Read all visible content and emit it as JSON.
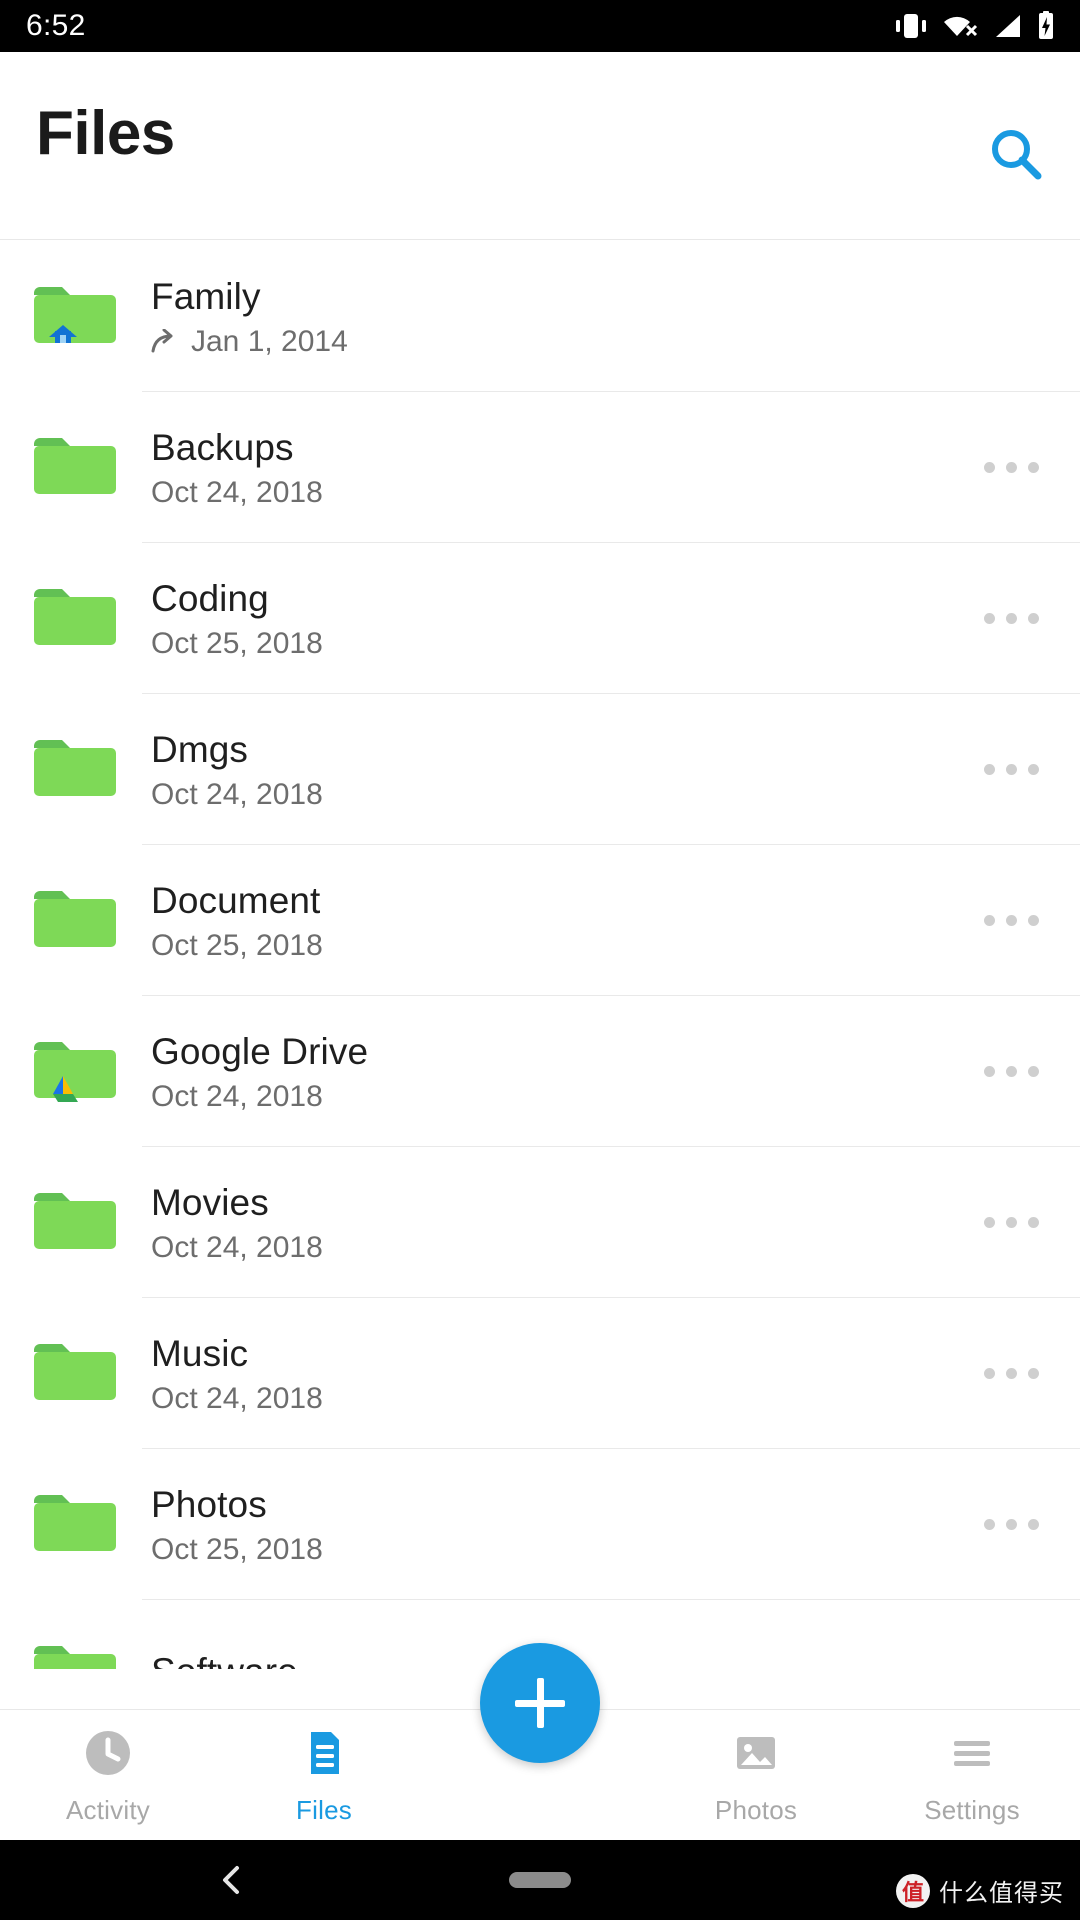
{
  "status_bar": {
    "time": "6:52",
    "icons": [
      "vibrate-icon",
      "wifi-no-internet-icon",
      "cellular-signal-icon",
      "battery-charging-icon"
    ]
  },
  "app_bar": {
    "title": "Files",
    "search_icon": "search-icon",
    "accent_color": "#1a9ae1"
  },
  "files": [
    {
      "name": "Family",
      "date": "Jan 1, 2014",
      "shared": true,
      "badge": "home-icon",
      "overflow": false
    },
    {
      "name": "Backups",
      "date": "Oct 24, 2018",
      "shared": false,
      "badge": null,
      "overflow": true
    },
    {
      "name": "Coding",
      "date": "Oct 25, 2018",
      "shared": false,
      "badge": null,
      "overflow": true
    },
    {
      "name": "Dmgs",
      "date": "Oct 24, 2018",
      "shared": false,
      "badge": null,
      "overflow": true
    },
    {
      "name": "Document",
      "date": "Oct 25, 2018",
      "shared": false,
      "badge": null,
      "overflow": true
    },
    {
      "name": "Google Drive",
      "date": "Oct 24, 2018",
      "shared": false,
      "badge": "google-drive-icon",
      "overflow": true
    },
    {
      "name": "Movies",
      "date": "Oct 24, 2018",
      "shared": false,
      "badge": null,
      "overflow": true
    },
    {
      "name": "Music",
      "date": "Oct 24, 2018",
      "shared": false,
      "badge": null,
      "overflow": true
    },
    {
      "name": "Photos",
      "date": "Oct 25, 2018",
      "shared": false,
      "badge": null,
      "overflow": true
    },
    {
      "name": "Software",
      "date": "",
      "shared": false,
      "badge": null,
      "overflow": true
    }
  ],
  "bottom_nav": {
    "items": [
      {
        "label": "Activity",
        "icon": "clock-icon",
        "active": false
      },
      {
        "label": "Files",
        "icon": "document-icon",
        "active": true
      },
      {
        "label": "Photos",
        "icon": "image-icon",
        "active": false
      },
      {
        "label": "Settings",
        "icon": "menu-icon",
        "active": false
      }
    ],
    "fab": {
      "icon": "plus-icon",
      "color": "#1a9ae1"
    }
  },
  "system_nav": {
    "back": "back-chevron-icon",
    "home": "home-pill-handle"
  },
  "watermark": {
    "badge": "值",
    "text": "什么值得买"
  }
}
